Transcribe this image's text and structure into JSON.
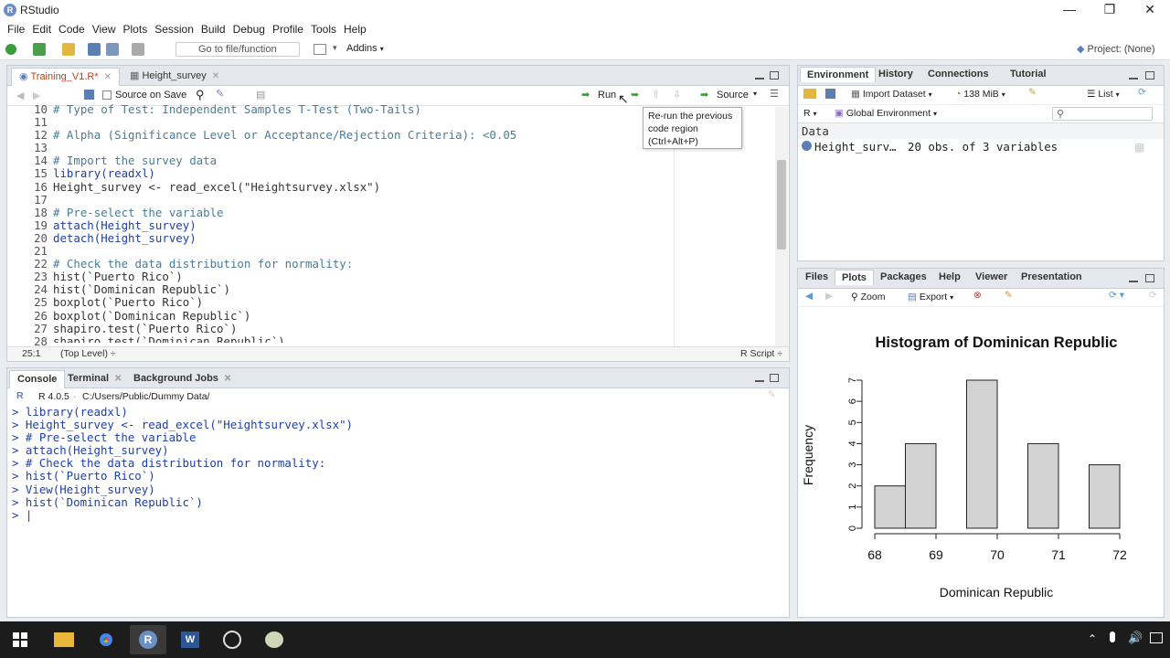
{
  "window": {
    "title": "RStudio",
    "minimize": "—",
    "restore": "❐",
    "close": "✕"
  },
  "menu": [
    "File",
    "Edit",
    "Code",
    "View",
    "Plots",
    "Session",
    "Build",
    "Debug",
    "Profile",
    "Tools",
    "Help"
  ],
  "toolbar": {
    "goto_placeholder": "Go to file/function",
    "addins": "Addins",
    "project": "Project: (None)"
  },
  "editor": {
    "tabs": [
      {
        "label": "Training_V1.R*",
        "active": true
      },
      {
        "label": "Height_survey",
        "active": false
      }
    ],
    "source_on_save": "Source on Save",
    "run_label": "Run",
    "source_label": "Source",
    "tooltip": [
      "Re-run the previous",
      "code region",
      "(Ctrl+Alt+P)"
    ],
    "line_numbers": [
      "10",
      "11",
      "12",
      "13",
      "14",
      "15",
      "16",
      "17",
      "18",
      "19",
      "20",
      "21",
      "22",
      "23",
      "24",
      "25",
      "26",
      "27",
      "28"
    ],
    "lines": [
      "# Type of Test: Independent Samples T-Test (Two-Tails)",
      "",
      "# Alpha (Significance Level or Acceptance/Rejection Criteria): <0.05",
      "",
      "# Import the survey data",
      "library(readxl)",
      "Height_survey <- read_excel(\"Heightsurvey.xlsx\")",
      "",
      "# Pre-select the variable",
      "attach(Height_survey)",
      "detach(Height_survey)",
      "",
      "# Check the data distribution for normality:",
      "hist(`Puerto Rico`)",
      "hist(`Dominican Republic`)",
      "boxplot(`Puerto Rico`)",
      "boxplot(`Dominican Republic`)",
      "shapiro.test(`Puerto Rico`)",
      "shapiro.test(`Dominican Republic`)"
    ],
    "status_pos": "25:1",
    "status_level": "(Top Level) ÷",
    "status_type": "R Script ÷"
  },
  "console": {
    "tabs": [
      "Console",
      "Terminal",
      "Background Jobs"
    ],
    "version": "R 4.0.5",
    "path": "C:/Users/Public/Dummy Data/",
    "lines": [
      "> library(readxl)",
      "> Height_survey <- read_excel(\"Heightsurvey.xlsx\")",
      "> # Pre-select the variable",
      "> attach(Height_survey)",
      "> # Check the data distribution for normality:",
      "> hist(`Puerto Rico`)",
      "> View(Height_survey)",
      "> hist(`Dominican Republic`)",
      "> |"
    ]
  },
  "environment": {
    "tabs": [
      "Environment",
      "History",
      "Connections",
      "Tutorial"
    ],
    "import_dataset": "Import Dataset",
    "memory": "138 MiB",
    "list_view": "List",
    "lang": "R",
    "scope": "Global Environment",
    "section": "Data",
    "row_name": "Height_surv…",
    "row_value": "20 obs. of 3 variables"
  },
  "files": {
    "tabs": [
      "Files",
      "Plots",
      "Packages",
      "Help",
      "Viewer",
      "Presentation"
    ],
    "zoom": "Zoom",
    "export": "Export"
  },
  "chart_data": {
    "type": "bar",
    "title": "Histogram of Dominican Republic",
    "xlabel": "Dominican Republic",
    "ylabel": "Frequency",
    "bins": [
      [
        68,
        68.5
      ],
      [
        68.5,
        69
      ],
      [
        69.5,
        70
      ],
      [
        70.5,
        71
      ],
      [
        71.5,
        72
      ]
    ],
    "values": [
      2,
      4,
      7,
      4,
      3
    ],
    "xlim": [
      68,
      72
    ],
    "ylim": [
      0,
      7
    ],
    "xticks": [
      "68",
      "69",
      "70",
      "71",
      "72"
    ],
    "yticks": [
      "0",
      "1",
      "2",
      "3",
      "4",
      "5",
      "6",
      "7"
    ],
    "bar_color": "#d3d3d3"
  },
  "colors": {
    "accent": "#4a7c96",
    "keyword": "#1f3fa6",
    "pane_bg": "#e9edf2"
  }
}
